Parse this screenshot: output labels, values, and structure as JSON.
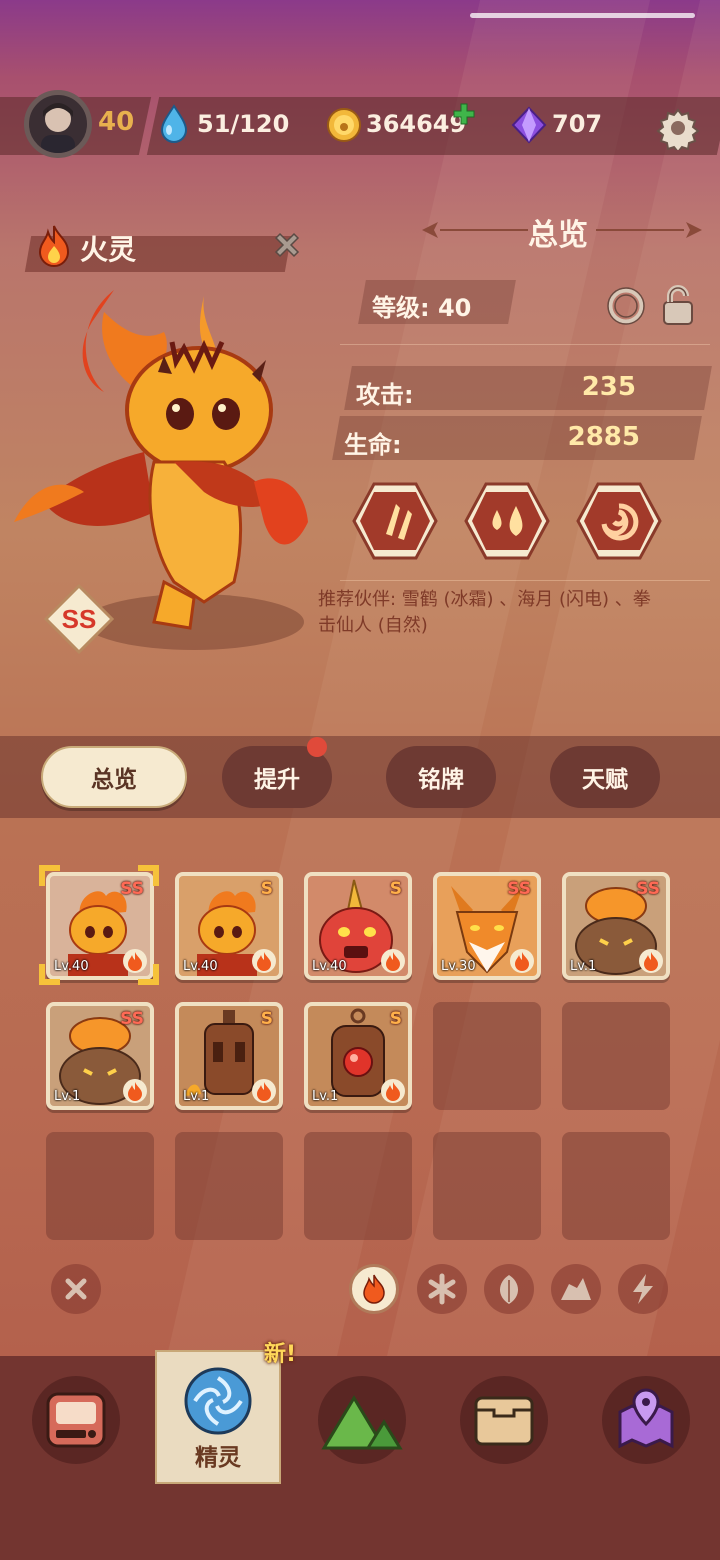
{
  "topbar": {
    "player_level": "40",
    "energy": "51/120",
    "coins": "364649",
    "gems": "707",
    "icons": [
      "avatar",
      "water-drop-icon",
      "coin-icon",
      "plus-icon",
      "gem-icon",
      "gear-icon"
    ]
  },
  "spirit": {
    "name": "火灵",
    "element": "fire",
    "rank": "SS"
  },
  "overview": {
    "title": "总览",
    "level_label": "等级: 40",
    "attack_label": "攻击:",
    "attack_value": "235",
    "hp_label": "生命:",
    "hp_value": "2885",
    "recommend": "推荐伙伴: 雪鹤 (冰霜) 、海月 (闪电) 、拳击仙人 (自然)"
  },
  "tabs": [
    {
      "label": "总览",
      "active": true
    },
    {
      "label": "提升",
      "badge": true
    },
    {
      "label": "铭牌"
    },
    {
      "label": "天赋"
    }
  ],
  "cards": [
    {
      "name": "fire-spirit-ss",
      "level": "Lv.40",
      "grade": "SS",
      "selected": true
    },
    {
      "name": "fire-spirit-s",
      "level": "Lv.40",
      "grade": "S"
    },
    {
      "name": "horn-blob",
      "level": "Lv.40",
      "grade": "S"
    },
    {
      "name": "fire-fox",
      "level": "Lv.30",
      "grade": "SS"
    },
    {
      "name": "lava-golem",
      "level": "Lv.1",
      "grade": "SS"
    },
    {
      "name": "lava-golem-2",
      "level": "Lv.1",
      "grade": "SS"
    },
    {
      "name": "iron-bot",
      "level": "Lv.1",
      "grade": "S"
    },
    {
      "name": "boiler-bot",
      "level": "Lv.1",
      "grade": "S"
    }
  ],
  "filters": [
    "clear",
    "fire",
    "ice",
    "nature",
    "earth",
    "lightning"
  ],
  "nav": {
    "selected_label": "精灵",
    "new_badge": "新!",
    "items": [
      "device-icon",
      "spirit-icon",
      "mountain-icon",
      "chest-icon",
      "map-pin-icon"
    ]
  },
  "colors": {
    "accent": "#f6ead0",
    "panel": "#733530",
    "value": "#ffe9a8"
  }
}
